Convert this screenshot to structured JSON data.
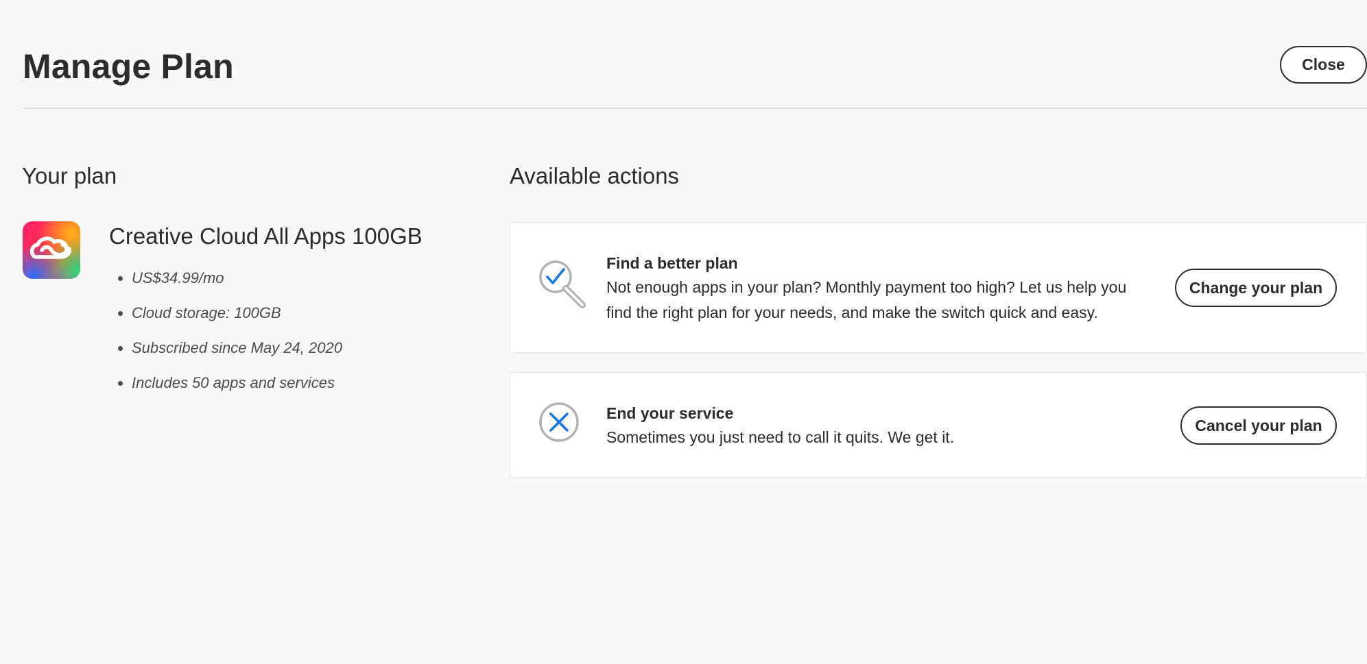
{
  "header": {
    "title": "Manage Plan",
    "close_label": "Close"
  },
  "plan": {
    "heading": "Your plan",
    "logo_icon": "creative-cloud-logo",
    "name": "Creative Cloud All Apps 100GB",
    "details": [
      "US$34.99/mo",
      "Cloud storage: 100GB",
      "Subscribed since May 24, 2020",
      "Includes 50 apps and services"
    ]
  },
  "actions": {
    "heading": "Available actions",
    "items": [
      {
        "icon": "magnifier-check-icon",
        "title": "Find a better plan",
        "description": "Not enough apps in your plan? Monthly payment too high? Let us help you find the right plan for your needs, and make the switch quick and easy.",
        "button_label": "Change your plan"
      },
      {
        "icon": "circle-x-icon",
        "title": "End your service",
        "description": "Sometimes you just need to call it quits. We get it.",
        "button_label": "Cancel your plan"
      }
    ]
  },
  "colors": {
    "background": "#f8f8f8",
    "text": "#2c2c2c",
    "accent": "#1473e6",
    "icon_gray": "#b3b3b3"
  }
}
